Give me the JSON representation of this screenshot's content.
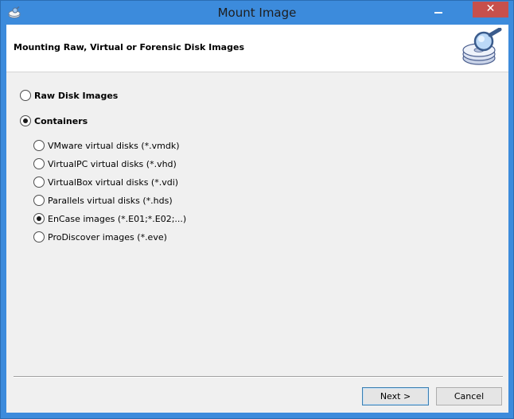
{
  "window": {
    "title": "Mount Image",
    "close_glyph": "✕",
    "app_icon": "disk-icon",
    "minimize_icon": "minimize-icon"
  },
  "header": {
    "title": "Mounting Raw, Virtual or Forensic Disk Images",
    "icon": "magnifier-disk-icon"
  },
  "options": {
    "raw": {
      "label": "Raw Disk Images",
      "checked": false
    },
    "containers": {
      "label": "Containers",
      "checked": true
    }
  },
  "container_types": [
    {
      "label": "VMware virtual disks (*.vmdk)",
      "checked": false
    },
    {
      "label": "VirtualPC virtual disks (*.vhd)",
      "checked": false
    },
    {
      "label": "VirtualBox virtual disks (*.vdi)",
      "checked": false
    },
    {
      "label": "Parallels virtual disks (*.hds)",
      "checked": false
    },
    {
      "label": "EnCase images (*.E01;*.E02;...)",
      "checked": true
    },
    {
      "label": "ProDiscover images (*.eve)",
      "checked": false
    }
  ],
  "footer": {
    "next_label": "Next >",
    "cancel_label": "Cancel"
  },
  "colors": {
    "titlebar": "#3c8bdc",
    "close_button": "#c7504c",
    "client_bg": "#f0f0f0"
  }
}
